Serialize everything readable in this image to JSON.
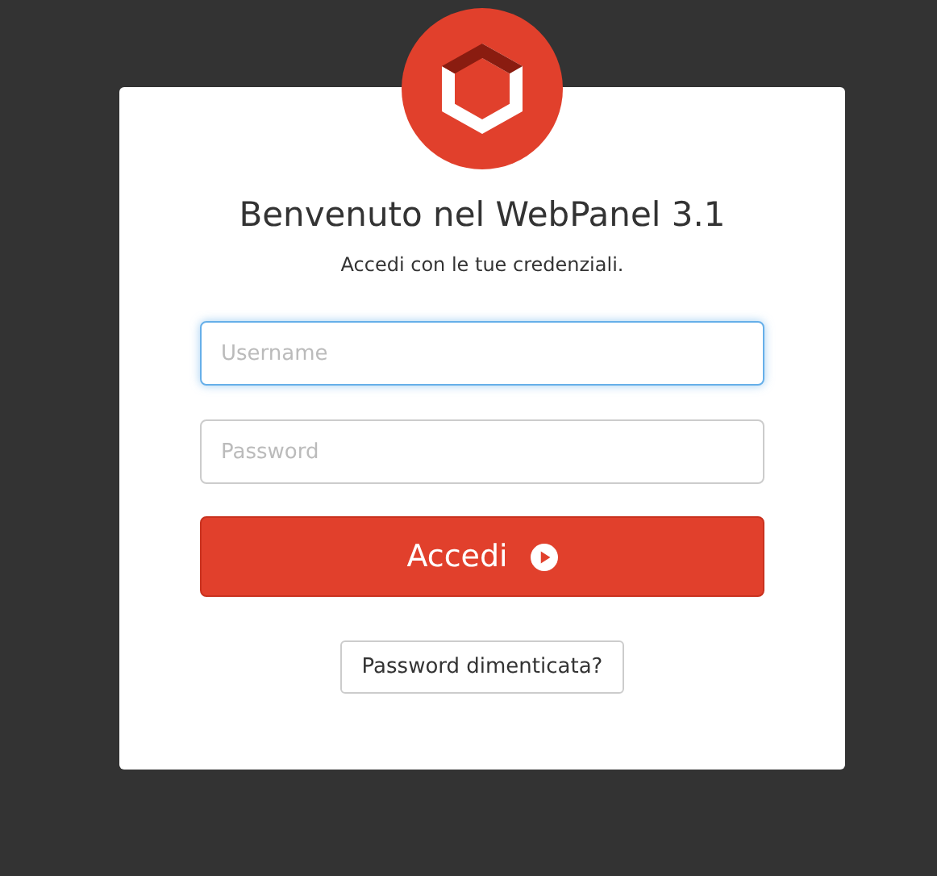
{
  "title": "Benvenuto nel WebPanel 3.1",
  "subtitle": "Accedi con le tue credenziali.",
  "fields": [
    {
      "placeholder": "Username",
      "focused": true
    },
    {
      "placeholder": "Password",
      "focused": false
    }
  ],
  "login_button": {
    "label": "Accedi"
  },
  "forgot_button": {
    "label": "Password dimenticata?"
  }
}
